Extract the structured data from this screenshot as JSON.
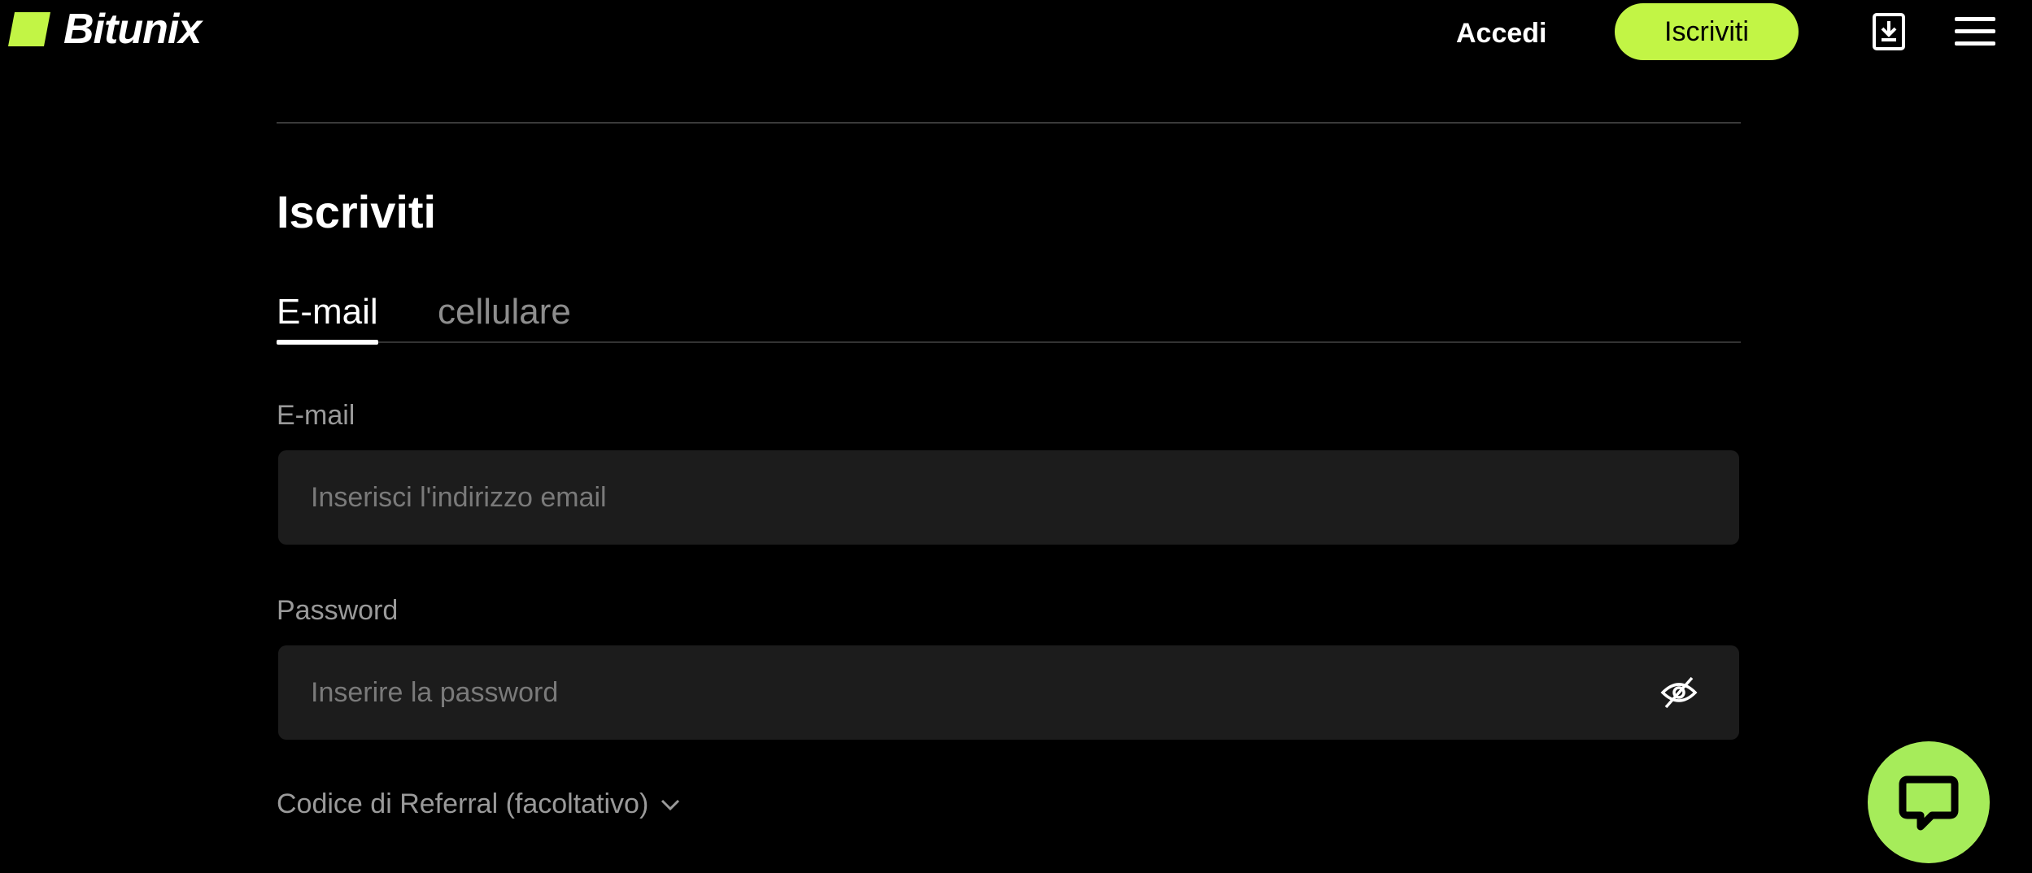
{
  "header": {
    "brand": "Bitunix",
    "login_label": "Accedi",
    "signup_label": "Iscriviti",
    "download_icon": "download-icon",
    "menu_icon": "hamburger-menu-icon"
  },
  "form": {
    "title": "Iscriviti",
    "tabs": [
      {
        "label": "E-mail",
        "active": true
      },
      {
        "label": "cellulare",
        "active": false
      }
    ],
    "email": {
      "label": "E-mail",
      "placeholder": "Inserisci l'indirizzo email",
      "value": ""
    },
    "password": {
      "label": "Password",
      "placeholder": "Inserire la password",
      "value": "",
      "toggle_icon": "eye-off-icon"
    },
    "referral_label": "Codice di Referral (facoltativo)"
  },
  "chat": {
    "icon": "chat-bubble-icon"
  },
  "colors": {
    "accent": "#c2f545",
    "chat": "#a6ec5a",
    "background": "#000000",
    "input_bg": "#1c1c1c"
  }
}
